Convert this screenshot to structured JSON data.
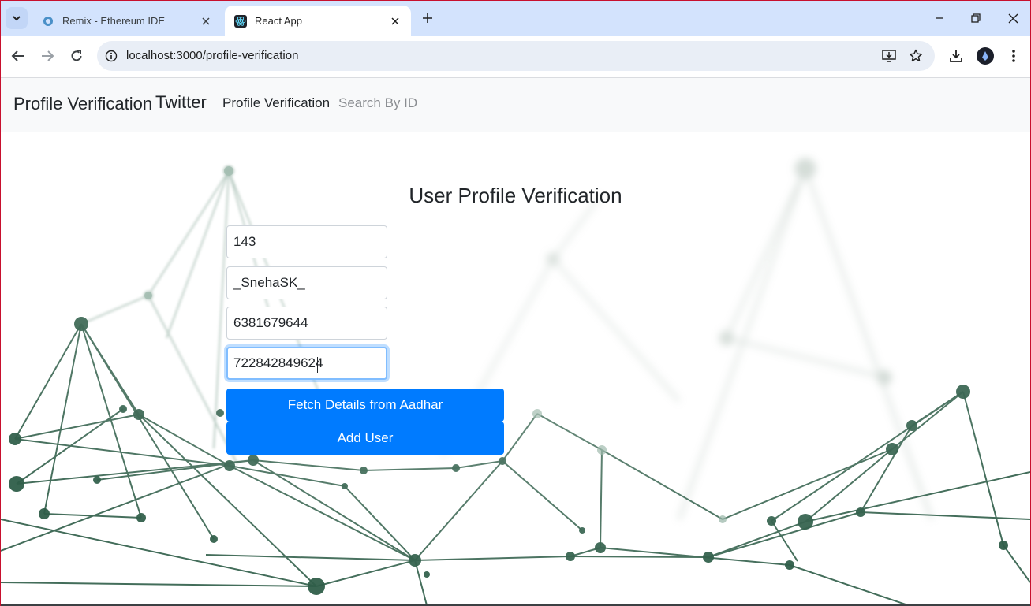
{
  "browser": {
    "tabs": [
      {
        "title": "Remix - Ethereum IDE",
        "active": false,
        "icon": "remix-logo-icon"
      },
      {
        "title": "React App",
        "active": true,
        "icon": "react-logo-icon"
      }
    ],
    "url": "localhost:3000/profile-verification"
  },
  "navbar": {
    "brand": "Profile Verification",
    "brand2": "Twitter",
    "links": [
      {
        "label": "Profile Verification",
        "active": true
      },
      {
        "label": "Search By ID",
        "active": false
      }
    ]
  },
  "form": {
    "heading": "User Profile Verification",
    "fields": [
      {
        "value": "143"
      },
      {
        "value": "_SnehaSK_"
      },
      {
        "value": "6381679644"
      },
      {
        "value": "722842849624",
        "focused": true
      }
    ],
    "fetch_button": "Fetch Details from Aadhar",
    "add_button": "Add User"
  },
  "colors": {
    "primary": "#007bff",
    "network": "#2f5e49",
    "tabstrip": "#d3e3fd"
  }
}
